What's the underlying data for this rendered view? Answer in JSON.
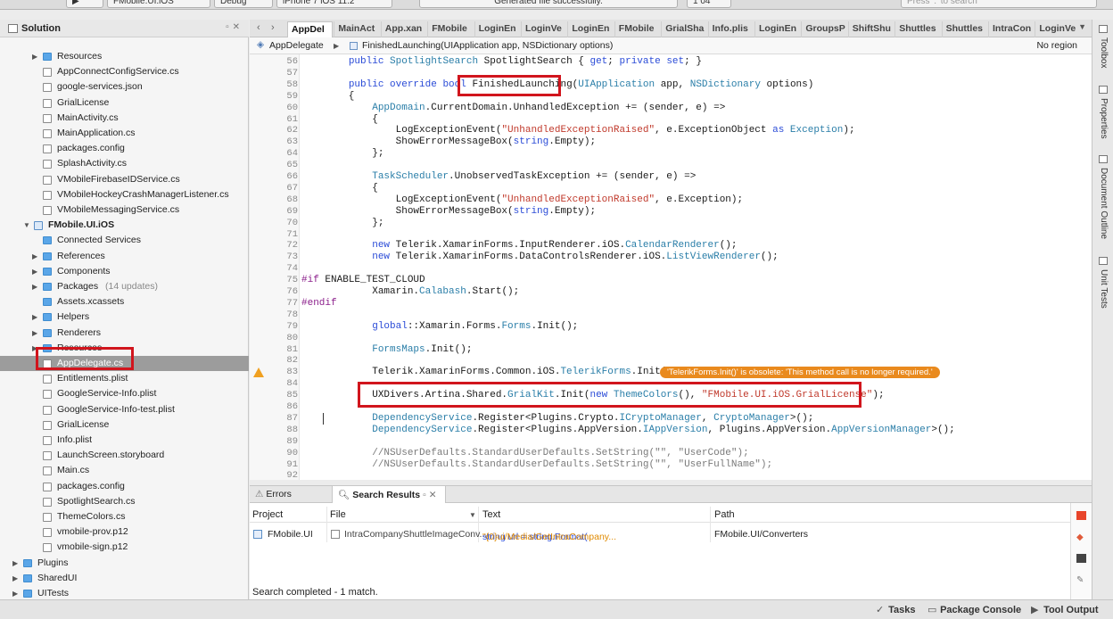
{
  "toolbar": {
    "config": "FMobile.UI.iOS",
    "mode": "Debug",
    "device": "iPhone 7 iOS 11.2",
    "status_message": "Generated file successfully.",
    "badge": "1 04",
    "search_placeholder": "Press '.' to search"
  },
  "solution_pad": {
    "title": "Solution",
    "items": [
      {
        "label": "Resources",
        "kind": "folder",
        "indent": 3,
        "arrow": "right",
        "note": ""
      },
      {
        "label": "AppConnectConfigService.cs",
        "kind": "file",
        "indent": 3,
        "arrow": "",
        "note": ""
      },
      {
        "label": "google-services.json",
        "kind": "file",
        "indent": 3,
        "arrow": "",
        "note": ""
      },
      {
        "label": "GrialLicense",
        "kind": "file",
        "indent": 3,
        "arrow": "",
        "note": ""
      },
      {
        "label": "MainActivity.cs",
        "kind": "file",
        "indent": 3,
        "arrow": "",
        "note": ""
      },
      {
        "label": "MainApplication.cs",
        "kind": "file",
        "indent": 3,
        "arrow": "",
        "note": ""
      },
      {
        "label": "packages.config",
        "kind": "file",
        "indent": 3,
        "arrow": "",
        "note": ""
      },
      {
        "label": "SplashActivity.cs",
        "kind": "file",
        "indent": 3,
        "arrow": "",
        "note": ""
      },
      {
        "label": "VMobileFirebaseIDService.cs",
        "kind": "file",
        "indent": 3,
        "arrow": "",
        "note": ""
      },
      {
        "label": "VMobileHockeyCrashManagerListener.cs",
        "kind": "file",
        "indent": 3,
        "arrow": "",
        "note": ""
      },
      {
        "label": "VMobileMessagingService.cs",
        "kind": "file",
        "indent": 3,
        "arrow": "",
        "note": ""
      },
      {
        "label": "FMobile.UI.iOS",
        "kind": "project",
        "indent": 2,
        "arrow": "down",
        "note": "",
        "bold": true
      },
      {
        "label": "Connected Services",
        "kind": "folder",
        "indent": 3,
        "arrow": "",
        "note": ""
      },
      {
        "label": "References",
        "kind": "folder",
        "indent": 3,
        "arrow": "right",
        "note": ""
      },
      {
        "label": "Components",
        "kind": "folder",
        "indent": 3,
        "arrow": "right",
        "note": ""
      },
      {
        "label": "Packages",
        "kind": "folder",
        "indent": 3,
        "arrow": "right",
        "note": "(14 updates)"
      },
      {
        "label": "Assets.xcassets",
        "kind": "folder",
        "indent": 3,
        "arrow": "",
        "note": ""
      },
      {
        "label": "Helpers",
        "kind": "folder",
        "indent": 3,
        "arrow": "right",
        "note": ""
      },
      {
        "label": "Renderers",
        "kind": "folder",
        "indent": 3,
        "arrow": "right",
        "note": ""
      },
      {
        "label": "Resources",
        "kind": "folder",
        "indent": 3,
        "arrow": "right",
        "note": ""
      },
      {
        "label": "AppDelegate.cs",
        "kind": "file",
        "indent": 3,
        "arrow": "",
        "note": "",
        "selected": true
      },
      {
        "label": "Entitlements.plist",
        "kind": "file",
        "indent": 3,
        "arrow": "",
        "note": ""
      },
      {
        "label": "GoogleService-Info.plist",
        "kind": "file",
        "indent": 3,
        "arrow": "",
        "note": ""
      },
      {
        "label": "GoogleService-Info-test.plist",
        "kind": "file",
        "indent": 3,
        "arrow": "",
        "note": ""
      },
      {
        "label": "GrialLicense",
        "kind": "file",
        "indent": 3,
        "arrow": "",
        "note": ""
      },
      {
        "label": "Info.plist",
        "kind": "file",
        "indent": 3,
        "arrow": "",
        "note": ""
      },
      {
        "label": "LaunchScreen.storyboard",
        "kind": "file",
        "indent": 3,
        "arrow": "",
        "note": ""
      },
      {
        "label": "Main.cs",
        "kind": "file",
        "indent": 3,
        "arrow": "",
        "note": ""
      },
      {
        "label": "packages.config",
        "kind": "file",
        "indent": 3,
        "arrow": "",
        "note": ""
      },
      {
        "label": "SpotlightSearch.cs",
        "kind": "file",
        "indent": 3,
        "arrow": "",
        "note": ""
      },
      {
        "label": "ThemeColors.cs",
        "kind": "file",
        "indent": 3,
        "arrow": "",
        "note": ""
      },
      {
        "label": "vmobile-prov.p12",
        "kind": "file",
        "indent": 3,
        "arrow": "",
        "note": ""
      },
      {
        "label": "vmobile-sign.p12",
        "kind": "file",
        "indent": 3,
        "arrow": "",
        "note": ""
      },
      {
        "label": "Plugins",
        "kind": "folder",
        "indent": 1,
        "arrow": "right",
        "note": ""
      },
      {
        "label": "SharedUI",
        "kind": "folder",
        "indent": 1,
        "arrow": "right",
        "note": ""
      },
      {
        "label": "UITests",
        "kind": "folder",
        "indent": 1,
        "arrow": "right",
        "note": ""
      }
    ]
  },
  "editor": {
    "tabs": [
      "AppDel",
      "MainAct",
      "App.xan",
      "FMobile",
      "LoginEn",
      "LoginVe",
      "LoginEn",
      "FMobile",
      "GrialSha",
      "Info.plis",
      "LoginEn",
      "GroupsP",
      "ShiftShu",
      "Shuttles",
      "Shuttles",
      "IntraCon",
      "LoginVe"
    ],
    "active_tab": 0,
    "breadcrumb_class": "AppDelegate",
    "breadcrumb_method": "FinishedLaunching(UIApplication app, NSDictionary options)",
    "breadcrumb_region": "No region",
    "warning_text": "'TelerikForms.Init()' is obsolete: 'This method call is no longer required.'",
    "lines": [
      {
        "n": "56",
        "html": "        <span class=\"kw\">public</span> <span class=\"ty\">SpotlightSearch</span> SpotlightSearch { <span class=\"kw\">get</span>; <span class=\"kw\">private</span> <span class=\"kw\">set</span>; }"
      },
      {
        "n": "57",
        "html": ""
      },
      {
        "n": "58",
        "html": "        <span class=\"kw\">public</span> <span class=\"kw\">override</span> <span class=\"kw\">bool</span> FinishedLaunching(<span class=\"ty\">UIApplication</span> app, <span class=\"ty\">NSDictionary</span> options)"
      },
      {
        "n": "59",
        "html": "        {"
      },
      {
        "n": "60",
        "html": "            <span class=\"ty\">AppDomain</span>.CurrentDomain.UnhandledException += (sender, e) =&gt;"
      },
      {
        "n": "61",
        "html": "            {"
      },
      {
        "n": "62",
        "html": "                LogExceptionEvent(<span class=\"str\">\"UnhandledExceptionRaised\"</span>, e.ExceptionObject <span class=\"kw\">as</span> <span class=\"ty\">Exception</span>);"
      },
      {
        "n": "63",
        "html": "                ShowErrorMessageBox(<span class=\"kw\">string</span>.Empty);"
      },
      {
        "n": "64",
        "html": "            };"
      },
      {
        "n": "65",
        "html": ""
      },
      {
        "n": "66",
        "html": "            <span class=\"ty\">TaskScheduler</span>.UnobservedTaskException += (sender, e) =&gt;"
      },
      {
        "n": "67",
        "html": "            {"
      },
      {
        "n": "68",
        "html": "                LogExceptionEvent(<span class=\"str\">\"UnhandledExceptionRaised\"</span>, e.Exception);"
      },
      {
        "n": "69",
        "html": "                ShowErrorMessageBox(<span class=\"kw\">string</span>.Empty);"
      },
      {
        "n": "70",
        "html": "            };"
      },
      {
        "n": "71",
        "html": ""
      },
      {
        "n": "72",
        "html": "            <span class=\"kw\">new</span> Telerik.XamarinForms.InputRenderer.iOS.<span class=\"ty\">CalendarRenderer</span>();"
      },
      {
        "n": "73",
        "html": "            <span class=\"kw\">new</span> Telerik.XamarinForms.DataControlsRenderer.iOS.<span class=\"ty\">ListViewRenderer</span>();"
      },
      {
        "n": "74",
        "html": ""
      },
      {
        "n": "75",
        "html": "<span class=\"pp\">#if</span> ENABLE_TEST_CLOUD"
      },
      {
        "n": "76",
        "html": "            Xamarin.<span class=\"ty\">Calabash</span>.Start();"
      },
      {
        "n": "77",
        "html": "<span class=\"pp\">#endif</span>"
      },
      {
        "n": "78",
        "html": ""
      },
      {
        "n": "79",
        "html": "            <span class=\"kw\">global</span>::Xamarin.Forms.<span class=\"ty\">Forms</span>.Init();"
      },
      {
        "n": "80",
        "html": ""
      },
      {
        "n": "81",
        "html": "            <span class=\"ty\">FormsMaps</span>.Init();"
      },
      {
        "n": "82",
        "html": ""
      },
      {
        "n": "83",
        "html": "            Telerik.XamarinForms.Common.iOS.<span class=\"ty\">TelerikForms</span>.Init();",
        "warn": true
      },
      {
        "n": "84",
        "html": ""
      },
      {
        "n": "85",
        "html": "            UXDivers.Artina.Shared.<span class=\"ty\">GrialKit</span>.Init(<span class=\"kw\">new</span> <span class=\"ty\">ThemeColors</span>(), <span class=\"str\">\"FMobile.UI.iOS.GrialLicense\"</span>);"
      },
      {
        "n": "86",
        "html": ""
      },
      {
        "n": "87",
        "html": "            <span class=\"ty\">DependencyService</span>.Register&lt;Plugins.Crypto.<span class=\"ty\">ICryptoManager</span>, <span class=\"ty\">CryptoManager</span>&gt;();"
      },
      {
        "n": "88",
        "html": "            <span class=\"ty\">DependencyService</span>.Register&lt;Plugins.AppVersion.<span class=\"ty\">IAppVersion</span>, Plugins.AppVersion.<span class=\"ty\">AppVersionManager</span>&gt;();"
      },
      {
        "n": "89",
        "html": ""
      },
      {
        "n": "90",
        "html": "            <span class=\"cm\">//NSUserDefaults.StandardUserDefaults.SetString(\"\", \"UserCode\");</span>"
      },
      {
        "n": "91",
        "html": "            <span class=\"cm\">//NSUserDefaults.StandardUserDefaults.SetString(\"\", \"UserFullName\");</span>"
      },
      {
        "n": "92",
        "html": ""
      }
    ]
  },
  "bottom_pad": {
    "tab_errors": "Errors",
    "tab_search": "Search Results",
    "columns": [
      "Project",
      "File",
      "Text",
      "Path"
    ],
    "result": {
      "project": "FMobile.UI",
      "file": "IntraCompanyShuttleImageConv...",
      "text_prefix": "string url = string.Format(",
      "text_highlight": "\"{0}ui/Media/GetIntraCompany...",
      "path": "FMobile.UI/Converters"
    },
    "status": "Search completed - 1 match."
  },
  "right_dock": [
    "Toolbox",
    "Properties",
    "Document Outline",
    "Unit Tests"
  ],
  "status_bar": {
    "tasks": "Tasks",
    "package_console": "Package Console",
    "tool_output": "Tool Output"
  },
  "colors": {
    "highlight_box": "#d1151d",
    "warning": "#e98a1e",
    "keyword": "#2a4bd7",
    "string": "#c0392b",
    "type": "#2a7ea8"
  }
}
